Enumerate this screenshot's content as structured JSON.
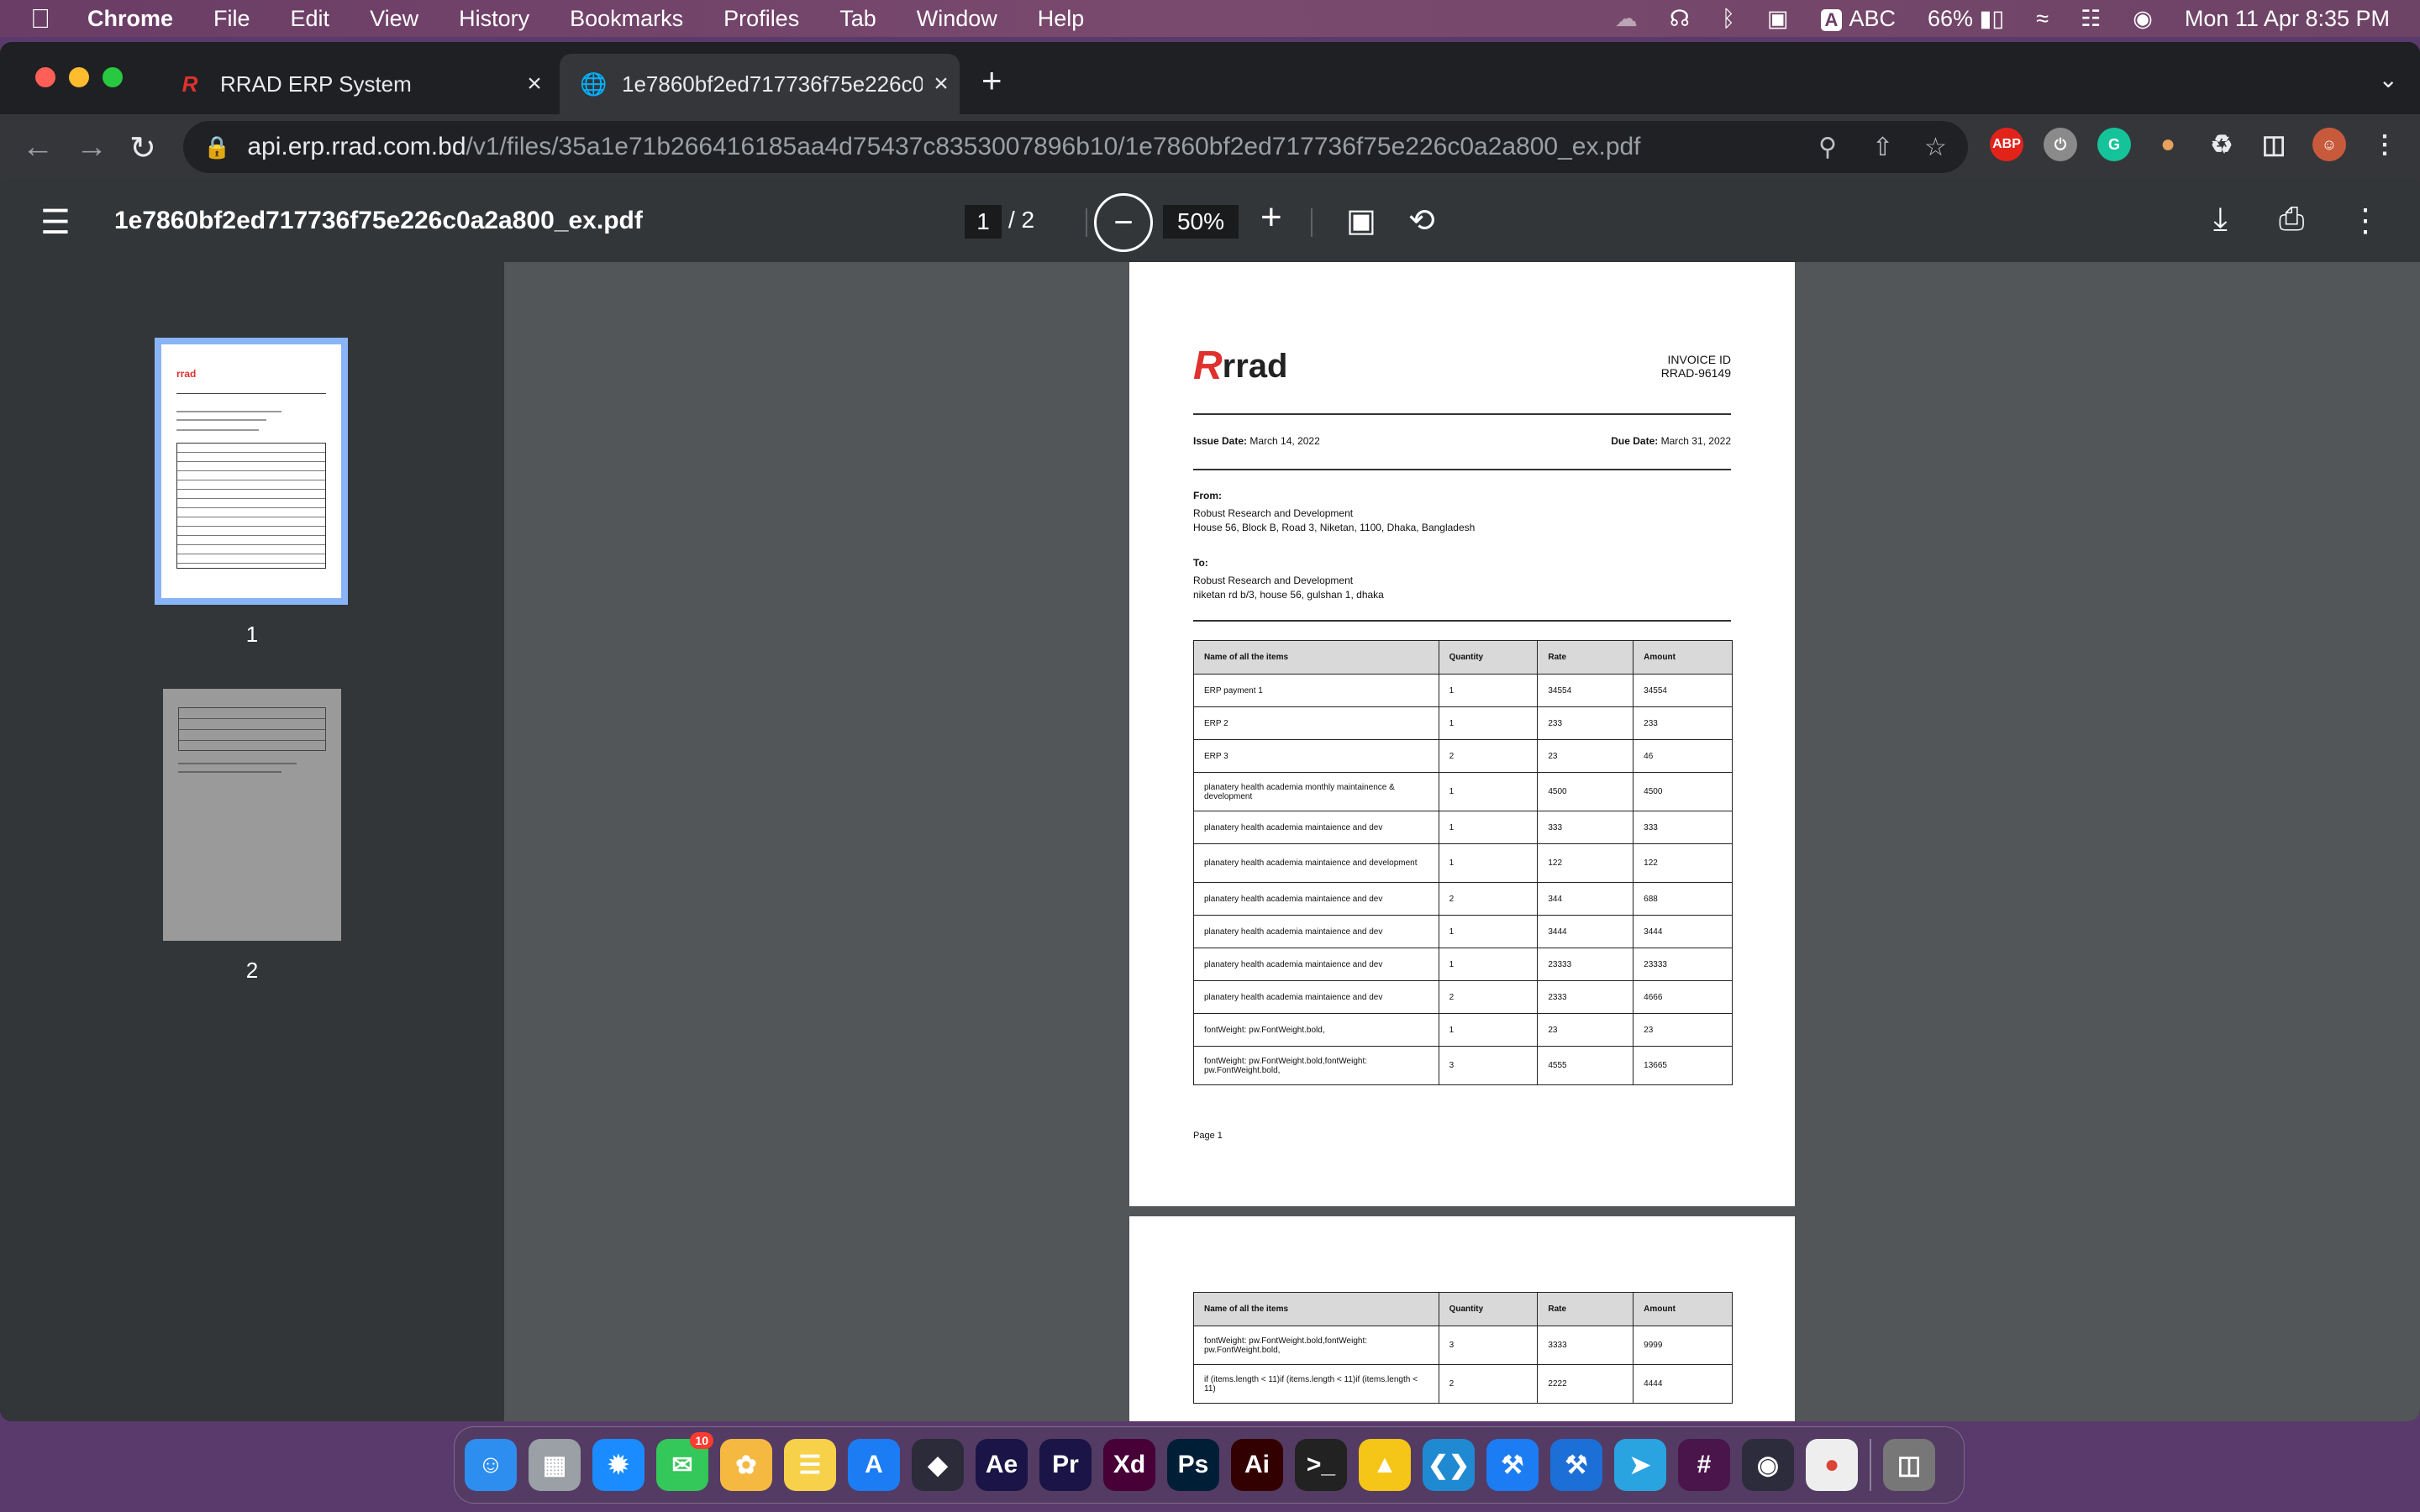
{
  "menubar": {
    "app": "Chrome",
    "items": [
      "File",
      "Edit",
      "View",
      "History",
      "Bookmarks",
      "Profiles",
      "Tab",
      "Window",
      "Help"
    ],
    "input_source": "ABC",
    "battery": "66%",
    "datetime": "Mon 11 Apr  8:35 PM"
  },
  "tabs": [
    {
      "title": "RRAD ERP System"
    },
    {
      "title": "1e7860bf2ed717736f75e226c0"
    }
  ],
  "omnibox": {
    "host": "api.erp.rrad.com.bd",
    "path": "/v1/files/35a1e71b266416185aa4d75437c8353007896b10/1e7860bf2ed717736f75e226c0a2a800_ex.pdf"
  },
  "extensions": {
    "abp": "ABP"
  },
  "pdf": {
    "filename": "1e7860bf2ed717736f75e226c0a2a800_ex.pdf",
    "current_page": "1",
    "page_total": "/ 2",
    "zoom": "50%",
    "thumb_labels": [
      "1",
      "2"
    ]
  },
  "invoice": {
    "logo_text": "rrad",
    "invoice_id_label": "INVOICE ID",
    "invoice_id": "RRAD-96149",
    "issue_label": "Issue Date:",
    "issue_date": "March 14, 2022",
    "due_label": "Due Date:",
    "due_date": "March 31, 2022",
    "from_label": "From:",
    "from_name": "Robust Research and Development",
    "from_address": "House 56, Block B, Road 3, Niketan, 1100, Dhaka, Bangladesh",
    "to_label": "To:",
    "to_name": "Robust Research and Development",
    "to_address": "niketan rd b/3,  house 56, gulshan 1, dhaka",
    "columns": [
      "Name of all the items",
      "Quantity",
      "Rate",
      "Amount"
    ],
    "rows": [
      [
        "ERP payment 1",
        "1",
        "34554",
        "34554"
      ],
      [
        "ERP 2",
        "1",
        "233",
        "233"
      ],
      [
        "ERP 3",
        "2",
        "23",
        "46"
      ],
      [
        "planatery health academia monthly maintainence & development",
        "1",
        "4500",
        "4500"
      ],
      [
        "planatery health academia maintaience and dev",
        "1",
        "333",
        "333"
      ],
      [
        "planatery health academia maintaience and development",
        "1",
        "122",
        "122"
      ],
      [
        "planatery health academia maintaience and dev",
        "2",
        "344",
        "688"
      ],
      [
        "planatery health academia maintaience and dev",
        "1",
        "3444",
        "3444"
      ],
      [
        "planatery health academia maintaience and dev",
        "1",
        "23333",
        "23333"
      ],
      [
        "planatery health academia maintaience and dev",
        "2",
        "2333",
        "4666"
      ],
      [
        "fontWeight: pw.FontWeight.bold,",
        "1",
        "23",
        "23"
      ],
      [
        "fontWeight: pw.FontWeight.bold,fontWeight: pw.FontWeight.bold,",
        "3",
        "4555",
        "13665"
      ]
    ],
    "page_label": "Page 1",
    "page2_rows": [
      [
        "fontWeight: pw.FontWeight.bold,fontWeight: pw.FontWeight.bold,",
        "3",
        "3333",
        "9999"
      ],
      [
        "if (items.length < 11)if (items.length < 11)if (items.length < 11)",
        "2",
        "2222",
        "4444"
      ]
    ]
  },
  "dock": {
    "apps": [
      {
        "name": "Finder",
        "label": ""
      },
      {
        "name": "Launchpad",
        "label": ""
      },
      {
        "name": "Safari",
        "label": ""
      },
      {
        "name": "Messages",
        "label": "",
        "badge": "10"
      },
      {
        "name": "Photos",
        "label": ""
      },
      {
        "name": "Notes",
        "label": ""
      },
      {
        "name": "App Store",
        "label": ""
      },
      {
        "name": "DaVinci Resolve",
        "label": ""
      },
      {
        "name": "After Effects",
        "label": "Ae"
      },
      {
        "name": "Premiere Pro",
        "label": "Pr"
      },
      {
        "name": "Adobe XD",
        "label": "Xd"
      },
      {
        "name": "Photoshop",
        "label": "Ps"
      },
      {
        "name": "Illustrator",
        "label": "Ai"
      },
      {
        "name": "Terminal",
        "label": ">_"
      },
      {
        "name": "Wireless Diagnostics",
        "label": ""
      },
      {
        "name": "VS Code",
        "label": ""
      },
      {
        "name": "Xcode",
        "label": ""
      },
      {
        "name": "Simulator",
        "label": ""
      },
      {
        "name": "Telegram",
        "label": ""
      },
      {
        "name": "Slack",
        "label": ""
      },
      {
        "name": "OBS",
        "label": ""
      },
      {
        "name": "Chrome",
        "label": ""
      },
      {
        "name": "Trash",
        "label": ""
      }
    ]
  },
  "colors": {
    "accent_thumb_border": "#8ab4f8",
    "logo_red": "#e0312e",
    "menubar": "#6a3d66"
  }
}
